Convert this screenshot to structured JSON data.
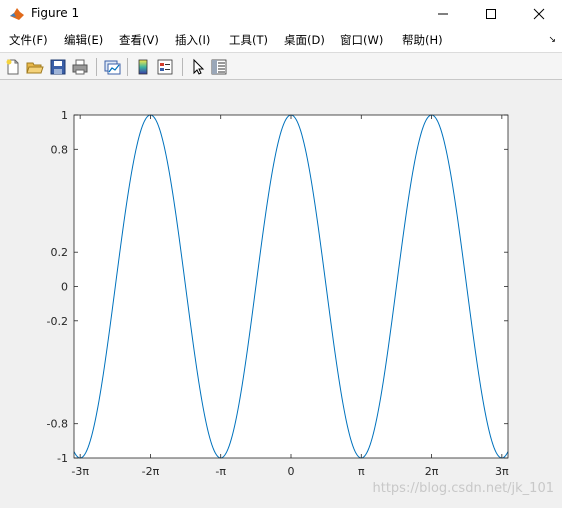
{
  "window": {
    "title": "Figure 1"
  },
  "menu": {
    "items": [
      {
        "label": "文件(F)"
      },
      {
        "label": "编辑(E)"
      },
      {
        "label": "查看(V)"
      },
      {
        "label": "插入(I)"
      },
      {
        "label": "工具(T)"
      },
      {
        "label": "桌面(D)"
      },
      {
        "label": "窗口(W)"
      },
      {
        "label": "帮助(H)"
      }
    ],
    "overflow_icon": "double-chevron-icon"
  },
  "toolbar": {
    "icons": [
      "new-figure-icon",
      "open-file-icon",
      "save-icon",
      "print-icon",
      "link-plot-icon",
      "insert-colorbar-icon",
      "insert-legend-icon",
      "select-pointer-icon",
      "property-inspector-icon"
    ]
  },
  "colors": {
    "line": "#0072bd",
    "axes_bg": "#ffffff",
    "figure_bg": "#f0f0f0"
  },
  "chart_data": {
    "type": "line",
    "function": "cos(x)",
    "xlim": [
      -9.7,
      9.7
    ],
    "ylim": [
      -1,
      1
    ],
    "xticks": [
      -9.42478,
      -6.28319,
      -3.14159,
      0,
      3.14159,
      6.28319,
      9.42478
    ],
    "xticklabels": [
      "-3π",
      "-2π",
      "-π",
      "0",
      "π",
      "2π",
      "3π"
    ],
    "yticks": [
      -1,
      -0.8,
      -0.2,
      0,
      0.2,
      0.8,
      1
    ],
    "yticklabels": [
      "-1",
      "-0.8",
      "-0.2",
      "0",
      "0.2",
      "0.8",
      "1"
    ],
    "series": [
      {
        "x_range": [
          -9.7,
          9.7
        ],
        "samples": 400
      }
    ],
    "grid": false
  },
  "watermark": "https://blog.csdn.net/jk_101"
}
